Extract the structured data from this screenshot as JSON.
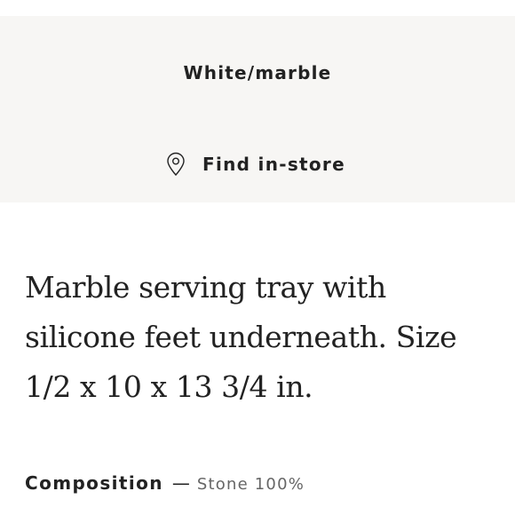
{
  "variant": {
    "name": "White/marble"
  },
  "find_in_store": {
    "label": "Find in-store",
    "icon": "location-pin-icon"
  },
  "product": {
    "description": "Marble serving tray with silicone feet underneath. Size 1/2 x 10 x 13 3/4 in."
  },
  "composition": {
    "label": "Composition",
    "separator": "—",
    "value": "Stone 100%"
  },
  "colors": {
    "panel_background": "#f7f6f4",
    "text": "#222222",
    "muted_text": "#666666"
  }
}
